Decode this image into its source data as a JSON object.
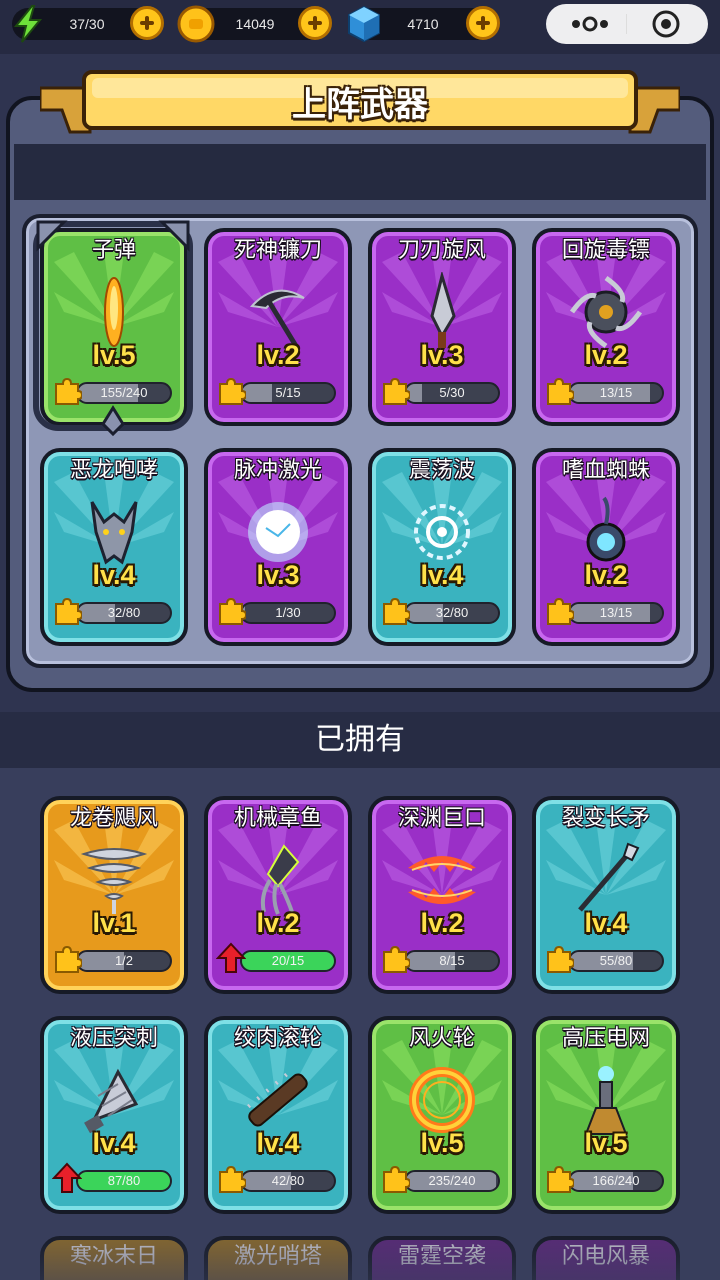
{
  "resources": {
    "energy": {
      "icon": "lightning-icon",
      "value": "37/30"
    },
    "gold": {
      "icon": "gold-coin-icon",
      "value": "14049"
    },
    "gem": {
      "icon": "blue-gem-icon",
      "value": "4710"
    }
  },
  "capsule": {
    "menu_icon": "more-dots-icon",
    "close_icon": "target-circle-icon"
  },
  "deploy": {
    "title": "上阵武器",
    "cards": [
      {
        "name": "子弹",
        "level": "lv.5",
        "progress": "155/240",
        "fraction": 0.65,
        "rarity": "green",
        "icon": "bullet-icon",
        "selected": true
      },
      {
        "name": "死神镰刀",
        "level": "lv.2",
        "progress": "5/15",
        "fraction": 0.33,
        "rarity": "purple",
        "icon": "scythe-icon"
      },
      {
        "name": "刀刃旋风",
        "level": "lv.3",
        "progress": "5/30",
        "fraction": 0.17,
        "rarity": "purple",
        "icon": "blade-icon"
      },
      {
        "name": "回旋毒镖",
        "level": "lv.2",
        "progress": "13/15",
        "fraction": 0.87,
        "rarity": "purple",
        "icon": "shuriken-icon"
      },
      {
        "name": "恶龙咆哮",
        "level": "lv.4",
        "progress": "32/80",
        "fraction": 0.4,
        "rarity": "teal",
        "icon": "dragon-head-icon"
      },
      {
        "name": "脉冲激光",
        "level": "lv.3",
        "progress": "1/30",
        "fraction": 0.03,
        "rarity": "purple",
        "icon": "laser-orb-icon"
      },
      {
        "name": "震荡波",
        "level": "lv.4",
        "progress": "32/80",
        "fraction": 0.4,
        "rarity": "teal",
        "icon": "shockwave-icon"
      },
      {
        "name": "嗜血蜘蛛",
        "level": "lv.2",
        "progress": "13/15",
        "fraction": 0.87,
        "rarity": "purple",
        "icon": "spider-icon"
      }
    ]
  },
  "owned": {
    "title": "已拥有",
    "cards": [
      {
        "name": "龙卷飓风",
        "level": "lv.1",
        "progress": "1/2",
        "fraction": 0.5,
        "rarity": "orange",
        "icon": "tornado-icon"
      },
      {
        "name": "机械章鱼",
        "level": "lv.2",
        "progress": "20/15",
        "fraction": 1.0,
        "rarity": "purple",
        "icon": "mech-squid-icon",
        "upgradable": true
      },
      {
        "name": "深渊巨口",
        "level": "lv.2",
        "progress": "8/15",
        "fraction": 0.53,
        "rarity": "purple",
        "icon": "abyss-maw-icon"
      },
      {
        "name": "裂变长矛",
        "level": "lv.4",
        "progress": "55/80",
        "fraction": 0.69,
        "rarity": "teal",
        "icon": "spear-icon"
      },
      {
        "name": "液压突刺",
        "level": "lv.4",
        "progress": "87/80",
        "fraction": 1.0,
        "rarity": "teal",
        "icon": "drill-icon",
        "upgradable": true
      },
      {
        "name": "绞肉滚轮",
        "level": "lv.4",
        "progress": "42/80",
        "fraction": 0.53,
        "rarity": "teal",
        "icon": "spiked-roller-icon"
      },
      {
        "name": "风火轮",
        "level": "lv.5",
        "progress": "235/240",
        "fraction": 0.98,
        "rarity": "green",
        "icon": "fire-wheel-icon"
      },
      {
        "name": "高压电网",
        "level": "lv.5",
        "progress": "166/240",
        "fraction": 0.69,
        "rarity": "green",
        "icon": "tesla-tower-icon"
      }
    ],
    "partial": [
      {
        "name": "寒冰末日",
        "rarity": "orange"
      },
      {
        "name": "激光哨塔",
        "rarity": "orange"
      },
      {
        "name": "雷霆空袭",
        "rarity": "purple"
      },
      {
        "name": "闪电风暴",
        "rarity": "purple"
      }
    ]
  },
  "colors": {
    "green": "#5fbf45",
    "purple": "#9a2fc7",
    "teal": "#3ab3bf",
    "orange": "#e79a1c",
    "level_text": "#ffe14a",
    "ribbon": "#ffd866",
    "background": "#2f3450"
  }
}
